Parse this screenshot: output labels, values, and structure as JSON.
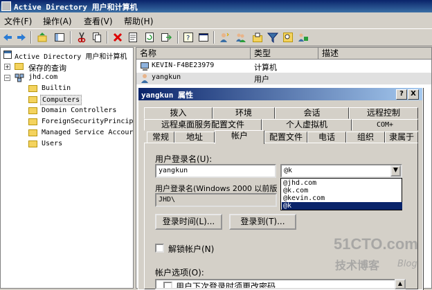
{
  "window": {
    "title": "Active Directory 用户和计算机"
  },
  "menu": [
    "文件(F)",
    "操作(A)",
    "查看(V)",
    "帮助(H)"
  ],
  "toolbar": {
    "icons": [
      "back-icon",
      "forward-icon",
      "up-icon",
      "show-tree-icon",
      "cut-icon",
      "copy-icon",
      "delete-icon",
      "properties-icon",
      "refresh-icon",
      "export-icon",
      "help-icon",
      "console-icon",
      "add-user-icon",
      "add-group-icon",
      "add-ou-icon",
      "filter-icon",
      "find-icon",
      "add-to-group-icon"
    ]
  },
  "tree": {
    "root": "Active Directory 用户和计算机",
    "saved_queries": "保存的查询",
    "domain": "jhd.com",
    "children": [
      "Builtin",
      "Computers",
      "Domain Controllers",
      "ForeignSecurityPrincip",
      "Managed Service Accour",
      "Users"
    ]
  },
  "list": {
    "columns": [
      "名称",
      "类型",
      "描述"
    ],
    "rows": [
      {
        "name": "KEVIN-F4BE23979",
        "type": "计算机",
        "icon": "computer-icon"
      },
      {
        "name": "yangkun",
        "type": "用户",
        "icon": "user-icon"
      }
    ]
  },
  "dialog": {
    "title": "yangkun 属性",
    "help_btn": "?",
    "close_btn": "X",
    "tabs_row1": [
      "拨入",
      "环境",
      "会话",
      "远程控制"
    ],
    "tabs_row2": [
      "远程桌面服务配置文件",
      "个人虚拟机",
      "COM+"
    ],
    "tabs_row3": [
      "常规",
      "地址",
      "帐户",
      "配置文件",
      "电话",
      "组织",
      "隶属于"
    ],
    "active_tab": "帐户",
    "logon_name_label": "用户登录名(U):",
    "logon_name_value": "yangkun",
    "domain_selected": "@k",
    "domain_options": [
      "@jhd.com",
      "@k.com",
      "@kevin.com",
      "@k"
    ],
    "pre2000_label": "用户登录名(Windows 2000 以前版",
    "pre2000_prefix": "JHD\\",
    "logon_hours_btn": "登录时间(L)...",
    "logon_to_btn": "登录到(T)...",
    "unlock_label": "解锁帐户(N)",
    "account_options_label": "帐户选项(O):",
    "option_first": "用户下次登录时须更改密码"
  },
  "watermark": {
    "site": "51CTO.com",
    "sub": "技术博客",
    "blog": "Blog"
  }
}
